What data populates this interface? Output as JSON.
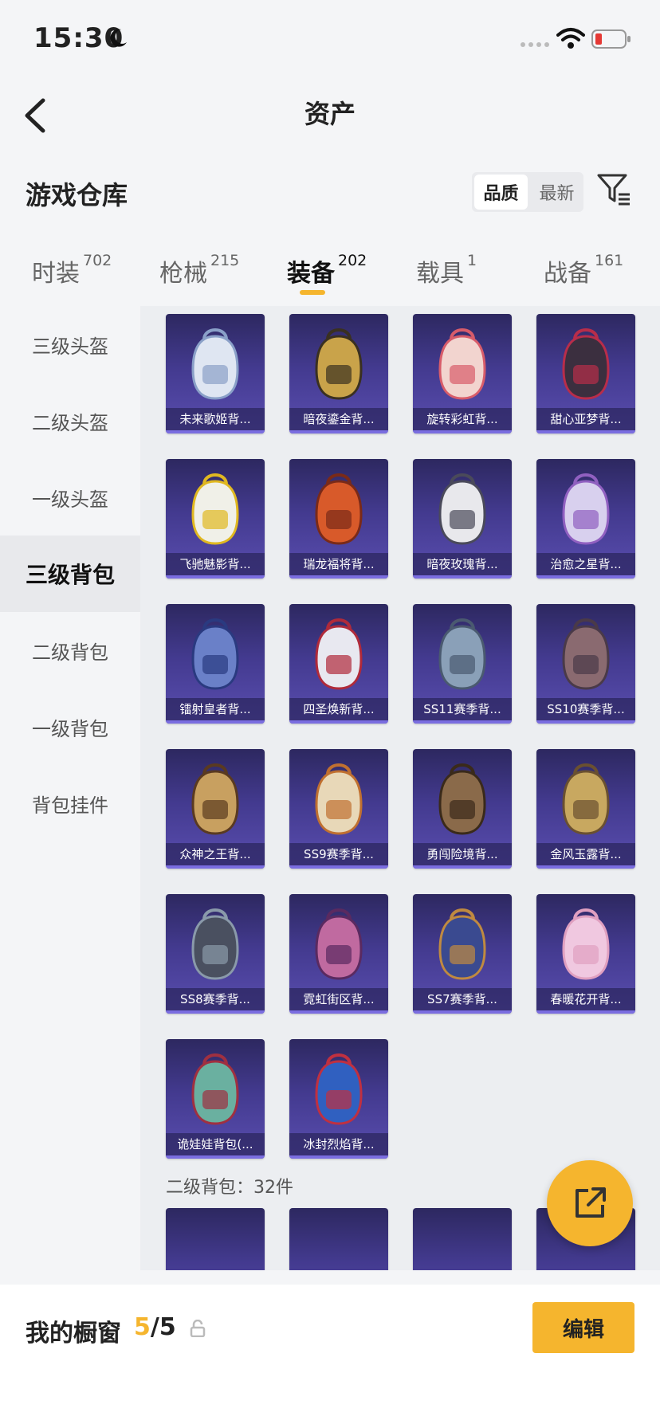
{
  "status_bar": {
    "time": "15:30"
  },
  "nav": {
    "title": "资产"
  },
  "section": {
    "title": "游戏仓库"
  },
  "sort": {
    "quality": "品质",
    "latest": "最新"
  },
  "tabs": [
    {
      "label": "时装",
      "count": "702"
    },
    {
      "label": "枪械",
      "count": "215"
    },
    {
      "label": "装备",
      "count": "202"
    },
    {
      "label": "载具",
      "count": "1"
    },
    {
      "label": "战备",
      "count": "161"
    }
  ],
  "sidebar": [
    {
      "label": "三级头盔"
    },
    {
      "label": "二级头盔"
    },
    {
      "label": "一级头盔"
    },
    {
      "label": "三级背包"
    },
    {
      "label": "二级背包"
    },
    {
      "label": "一级背包"
    },
    {
      "label": "背包挂件"
    }
  ],
  "items": [
    {
      "label": "未来歌姬背...",
      "icon": "backpack-icon"
    },
    {
      "label": "暗夜鎏金背...",
      "icon": "backpack-icon"
    },
    {
      "label": "旋转彩虹背...",
      "icon": "backpack-icon"
    },
    {
      "label": "甜心亚梦背...",
      "icon": "backpack-icon"
    },
    {
      "label": "飞驰魅影背...",
      "icon": "backpack-icon"
    },
    {
      "label": "瑞龙福将背...",
      "icon": "backpack-icon"
    },
    {
      "label": "暗夜玫瑰背...",
      "icon": "backpack-icon"
    },
    {
      "label": "治愈之星背...",
      "icon": "backpack-icon"
    },
    {
      "label": "镭射皇者背...",
      "icon": "backpack-icon"
    },
    {
      "label": "四圣焕新背...",
      "icon": "backpack-icon"
    },
    {
      "label": "SS11赛季背...",
      "icon": "backpack-icon"
    },
    {
      "label": "SS10赛季背...",
      "icon": "backpack-icon"
    },
    {
      "label": "众神之王背...",
      "icon": "backpack-icon"
    },
    {
      "label": "SS9赛季背...",
      "icon": "backpack-icon"
    },
    {
      "label": "勇闯险境背...",
      "icon": "backpack-icon"
    },
    {
      "label": "金风玉露背...",
      "icon": "backpack-icon"
    },
    {
      "label": "SS8赛季背...",
      "icon": "backpack-icon"
    },
    {
      "label": "霓虹街区背...",
      "icon": "backpack-icon"
    },
    {
      "label": "SS7赛季背...",
      "icon": "backpack-icon"
    },
    {
      "label": "春暖花开背...",
      "icon": "backpack-icon"
    },
    {
      "label": "诡娃娃背包(...",
      "icon": "backpack-icon"
    },
    {
      "label": "冰封烈焰背...",
      "icon": "backpack-icon"
    }
  ],
  "sub_section": {
    "label": "二级背包：32件"
  },
  "bottom": {
    "showcase_label": "我的橱窗",
    "current": "5",
    "total": "/5",
    "edit": "编辑"
  },
  "colors": {
    "accent": "#f5b52e",
    "card_bg": "#433a8f"
  }
}
